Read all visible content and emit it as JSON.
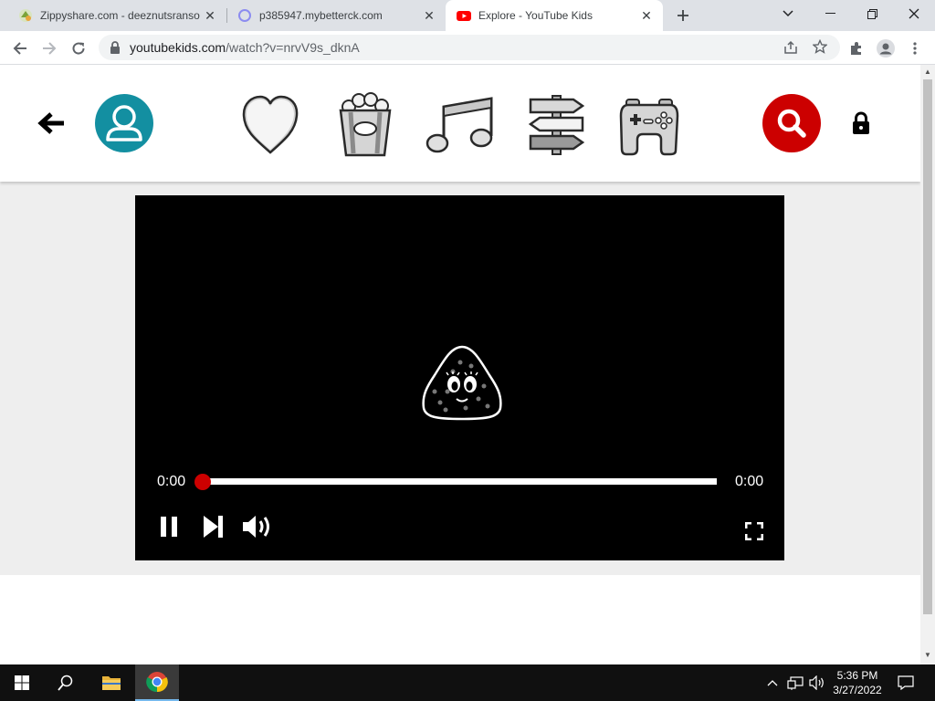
{
  "browser": {
    "tabs": [
      {
        "title": "Zippyshare.com - deeznutsranso",
        "favicon": "zippyshare-favicon",
        "active": false
      },
      {
        "title": "p385947.mybetterck.com",
        "favicon": "loading-globe-favicon",
        "active": false
      },
      {
        "title": "Explore - YouTube Kids",
        "favicon": "youtube-favicon",
        "active": true
      }
    ],
    "url_host": "youtubekids.com",
    "url_path": "/watch?v=nrvV9s_dknA"
  },
  "yk_nav": {
    "categories": [
      "heart-icon",
      "popcorn-icon",
      "music-note-icon",
      "signpost-icon",
      "gamepad-icon"
    ],
    "colors": {
      "avatar": "#138fa1",
      "search": "#cc0000"
    }
  },
  "player": {
    "current_time": "0:00",
    "duration": "0:00",
    "progress": 0.0,
    "accent": "#cc0000"
  },
  "taskbar": {
    "time": "5:36 PM",
    "date": "3/27/2022"
  }
}
